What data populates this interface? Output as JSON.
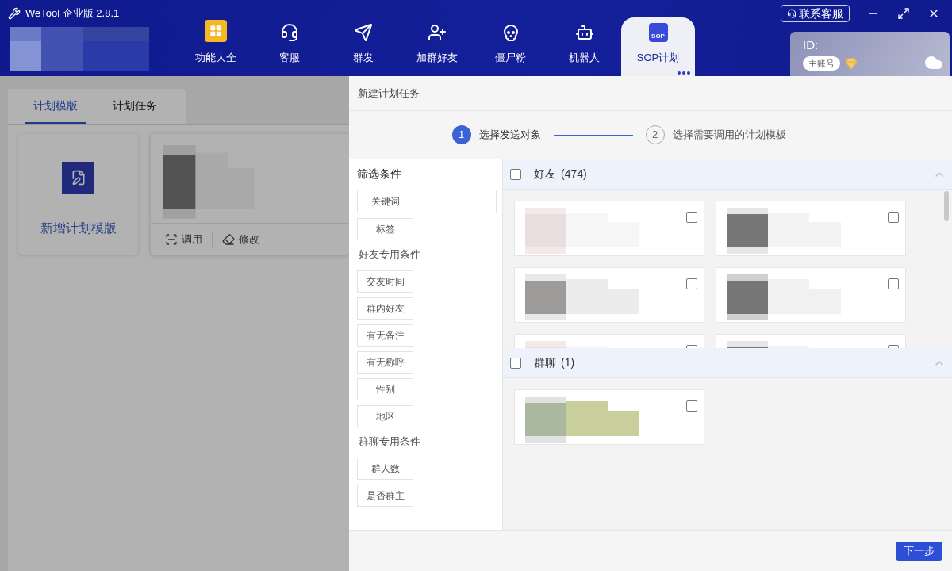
{
  "app_title": "WeTool 企业版 2.8.1",
  "nav": [
    {
      "label": "功能大全",
      "selected": false
    },
    {
      "label": "客服",
      "selected": false
    },
    {
      "label": "群发",
      "selected": false
    },
    {
      "label": "加群好友",
      "selected": false
    },
    {
      "label": "僵尸粉",
      "selected": false
    },
    {
      "label": "机器人",
      "selected": false
    },
    {
      "label": "SOP计划",
      "icon_text": "SOP",
      "selected": true
    }
  ],
  "contact_button": "联系客服",
  "account": {
    "id_label": "ID:",
    "badge": "主账号"
  },
  "page_tabs": [
    {
      "label": "计划模版",
      "selected": true
    },
    {
      "label": "计划任务",
      "selected": false
    }
  ],
  "new_template_label": "新增计划模版",
  "template_actions": [
    {
      "label": "调用"
    },
    {
      "label": "修改"
    }
  ],
  "drawer": {
    "title": "新建计划任务",
    "steps": [
      {
        "number": "1",
        "label": "选择发送对象",
        "selected": true
      },
      {
        "number": "2",
        "label": "选择需要调用的计划模板",
        "selected": false
      }
    ],
    "filter_groups": [
      {
        "title": "筛选条件",
        "items": [
          {
            "label": "关键词",
            "kind": "input"
          },
          {
            "label": "标签",
            "kind": "button"
          }
        ]
      },
      {
        "title": "好友专用条件",
        "items": [
          {
            "label": "交友时间",
            "kind": "button"
          },
          {
            "label": "群内好友",
            "kind": "button"
          },
          {
            "label": "有无备注",
            "kind": "button"
          },
          {
            "label": "有无称呼",
            "kind": "button"
          },
          {
            "label": "性别",
            "kind": "button"
          },
          {
            "label": "地区",
            "kind": "button"
          }
        ]
      },
      {
        "title": "群聊专用条件",
        "items": [
          {
            "label": "群人数",
            "kind": "button"
          },
          {
            "label": "是否群主",
            "kind": "button"
          }
        ]
      }
    ],
    "sections": [
      {
        "title": "好友",
        "count": "(474)",
        "checked": false,
        "expanded": true,
        "contacts": [
          {
            "checked": false
          },
          {
            "checked": false
          },
          {
            "checked": false
          },
          {
            "checked": false
          },
          {
            "checked": false
          },
          {
            "checked": false
          }
        ]
      },
      {
        "title": "群聊",
        "count": "(1)",
        "checked": false,
        "expanded": true,
        "contacts": [
          {
            "checked": false
          }
        ]
      }
    ],
    "next_button": "下一步"
  }
}
